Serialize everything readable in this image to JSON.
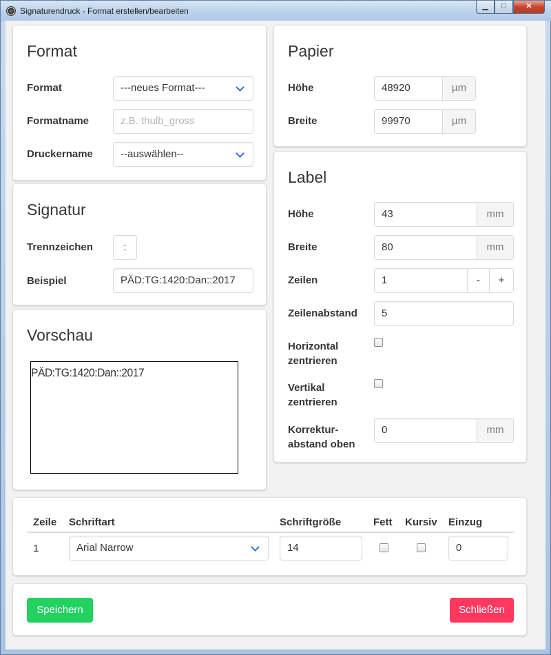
{
  "window": {
    "title": "Signaturendruck - Format erstellen/bearbeiten",
    "min_glyph": "▁",
    "max_glyph": "□",
    "close_glyph": "✕"
  },
  "format_card": {
    "title": "Format",
    "format_label": "Format",
    "format_value": "---neues Format---",
    "formatname_label": "Formatname",
    "formatname_placeholder": "z.B. thulb_gross",
    "drucker_label": "Druckername",
    "drucker_value": "--auswählen--"
  },
  "papier_card": {
    "title": "Papier",
    "hoehe_label": "Höhe",
    "hoehe_value": "48920",
    "hoehe_unit": "µm",
    "breite_label": "Breite",
    "breite_value": "99970",
    "breite_unit": "µm"
  },
  "signatur_card": {
    "title": "Signatur",
    "trenn_label": "Trennzeichen",
    "trenn_value": ":",
    "beispiel_label": "Beispiel",
    "beispiel_value": "PÄD:TG:1420:Dan::2017"
  },
  "label_card": {
    "title": "Label",
    "hoehe_label": "Höhe",
    "hoehe_value": "43",
    "hoehe_unit": "mm",
    "breite_label": "Breite",
    "breite_value": "80",
    "breite_unit": "mm",
    "zeilen_label": "Zeilen",
    "zeilen_value": "1",
    "zeilen_minus": "-",
    "zeilen_plus": "+",
    "zeilenabstand_label": "Zeilenabstand",
    "zeilenabstand_value": "5",
    "horizontal_label_1": "Horizontal",
    "horizontal_label_2": "zentrieren",
    "vertikal_label_1": "Vertikal",
    "vertikal_label_2": "zentrieren",
    "korrektur_label_1": "Korrektur-",
    "korrektur_label_2": "abstand oben",
    "korrektur_value": "0",
    "korrektur_unit": "mm"
  },
  "vorschau_card": {
    "title": "Vorschau",
    "preview_text": "PÄD:TG:1420:Dan::2017"
  },
  "lines_table": {
    "headers": {
      "zeile": "Zeile",
      "schriftart": "Schriftart",
      "schriftgroesse": "Schriftgröße",
      "fett": "Fett",
      "kursiv": "Kursiv",
      "einzug": "Einzug"
    },
    "rows": [
      {
        "zeile": "1",
        "schriftart": "Arial Narrow",
        "schriftgroesse": "14",
        "fett": false,
        "kursiv": false,
        "einzug": "0"
      }
    ]
  },
  "actions": {
    "save_label": "Speichern",
    "close_label": "Schließen"
  }
}
